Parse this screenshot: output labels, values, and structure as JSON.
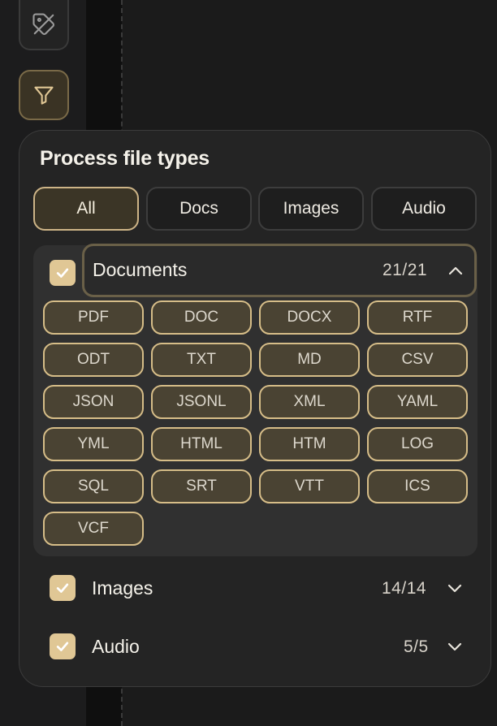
{
  "rail": {
    "buttons": [
      {
        "name": "tag-off",
        "icon": "tag-off-icon"
      },
      {
        "name": "filter",
        "icon": "filter-icon",
        "active": true
      }
    ]
  },
  "panel": {
    "title": "Process file types",
    "tabs": [
      {
        "label": "All",
        "active": true
      },
      {
        "label": "Docs",
        "active": false
      },
      {
        "label": "Images",
        "active": false
      },
      {
        "label": "Audio",
        "active": false
      }
    ],
    "groups": [
      {
        "label": "Documents",
        "count": "21/21",
        "checked": true,
        "expanded": true,
        "types": [
          "PDF",
          "DOC",
          "DOCX",
          "RTF",
          "ODT",
          "TXT",
          "MD",
          "CSV",
          "JSON",
          "JSONL",
          "XML",
          "YAML",
          "YML",
          "HTML",
          "HTM",
          "LOG",
          "SQL",
          "SRT",
          "VTT",
          "ICS",
          "VCF"
        ]
      },
      {
        "label": "Images",
        "count": "14/14",
        "checked": true,
        "expanded": false
      },
      {
        "label": "Audio",
        "count": "5/5",
        "checked": true,
        "expanded": false
      }
    ]
  },
  "colors": {
    "accent": "#e0c795",
    "chip_border": "#d6bd88",
    "chip_bg": "#4a4333",
    "panel_bg": "#242424"
  }
}
